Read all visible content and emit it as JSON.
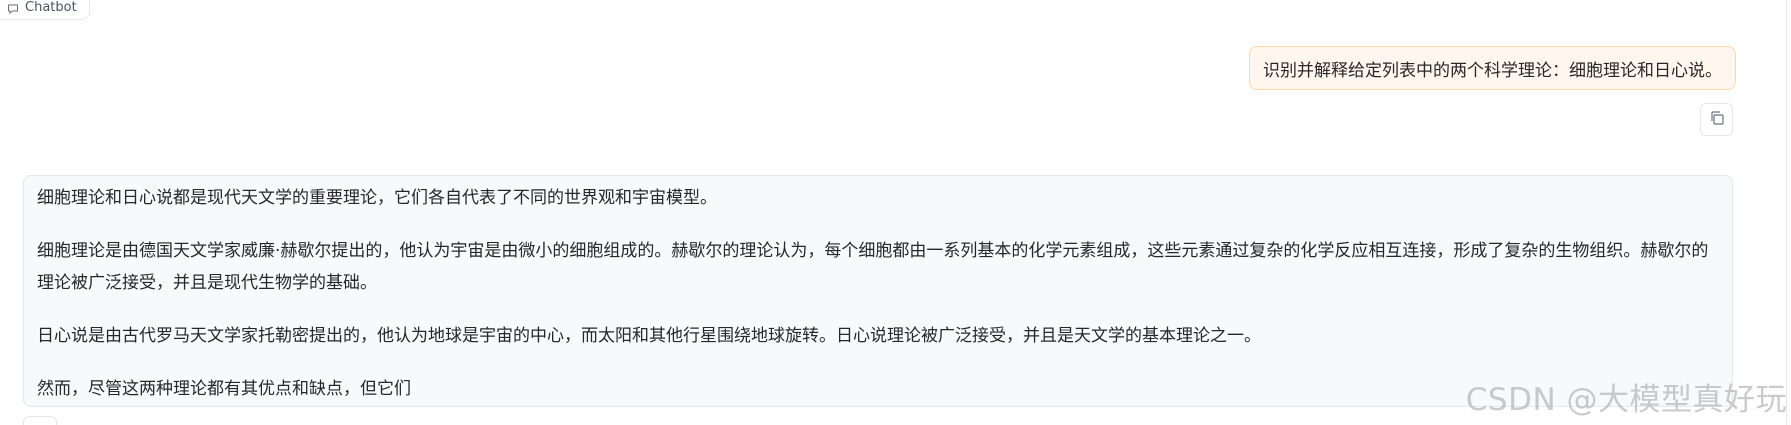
{
  "chatbot_tab": {
    "label": "Chatbot",
    "icon": "chat-bubble-icon"
  },
  "user_message": {
    "text": "识别并解释给定列表中的两个科学理论：细胞理论和日心说。"
  },
  "copy_button": {
    "icon": "copy-icon"
  },
  "bot_message": {
    "paragraphs": [
      "细胞理论和日心说都是现代天文学的重要理论，它们各自代表了不同的世界观和宇宙模型。",
      "细胞理论是由德国天文学家威廉·赫歇尔提出的，他认为宇宙是由微小的细胞组成的。赫歇尔的理论认为，每个细胞都由一系列基本的化学元素组成，这些元素通过复杂的化学反应相互连接，形成了复杂的生物组织。赫歇尔的理论被广泛接受，并且是现代生物学的基础。",
      "日心说是由古代罗马天文学家托勒密提出的，他认为地球是宇宙的中心，而太阳和其他行星围绕地球旋转。日心说理论被广泛接受，并且是天文学的基本理论之一。",
      "然而，尽管这两种理论都有其优点和缺点，但它们"
    ]
  },
  "watermark": {
    "text": "CSDN @大模型真好玩"
  },
  "colors": {
    "user_bubble_bg": "#fff7ed",
    "user_bubble_border": "#fed7aa",
    "bot_bubble_bg": "#f8f9fb",
    "border": "#e5e7eb"
  }
}
